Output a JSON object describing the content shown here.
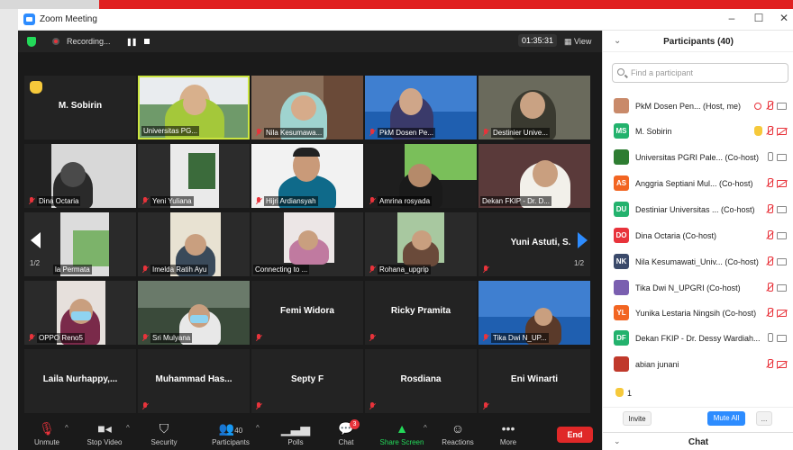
{
  "window": {
    "title": "Zoom Meeting",
    "controls": [
      "–",
      "☐",
      "✕"
    ]
  },
  "topbar": {
    "recording_label": "Recording...",
    "timer": "01:35:31",
    "view_label": "View"
  },
  "tiles": [
    {
      "name": "M. Sobirin",
      "label": "",
      "hand": true
    },
    {
      "name": "",
      "label": "Universitas PG...",
      "selected": true
    },
    {
      "name": "",
      "label": "Nila Kesumawa..."
    },
    {
      "name": "",
      "label": "PkM Dosen Pe..."
    },
    {
      "name": "",
      "label": "Destinier Unive..."
    },
    {
      "name": "",
      "label": "Dina Octaria"
    },
    {
      "name": "",
      "label": "Yeni Yuliana"
    },
    {
      "name": "",
      "label": "Hijri Ardiansyah"
    },
    {
      "name": "",
      "label": "Amrina rosyada"
    },
    {
      "name": "",
      "label": "Dekan FKIP - Dr. D..."
    },
    {
      "name": "",
      "label": "la Permata"
    },
    {
      "name": "",
      "label": "Imelda Ratih Ayu"
    },
    {
      "name": "",
      "label": "Connecting to ..."
    },
    {
      "name": "",
      "label": "Rohana_upgrip"
    },
    {
      "name": "Yuni Astuti, S.",
      "label": ""
    },
    {
      "name": "",
      "label": "OPPO Reno5"
    },
    {
      "name": "",
      "label": "Sri Mulyana"
    },
    {
      "name": "Femi Widora",
      "label": ""
    },
    {
      "name": "Ricky Pramita",
      "label": ""
    },
    {
      "name": "",
      "label": "Tika Dwi N_UP..."
    },
    {
      "name": "Laila Nurhappy,...",
      "label": ""
    },
    {
      "name": "Muhammad Has...",
      "label": ""
    },
    {
      "name": "Septy F",
      "label": ""
    },
    {
      "name": "Rosdiana",
      "label": ""
    },
    {
      "name": "Eni Winarti",
      "label": ""
    }
  ],
  "pager": {
    "left": "1/2",
    "right": "1/2"
  },
  "toolbar": {
    "unmute": "Unmute",
    "stop_video": "Stop Video",
    "security": "Security",
    "participants": "Participants",
    "participants_count": "40",
    "polls": "Polls",
    "chat": "Chat",
    "chat_badge": "3",
    "share_screen": "Share Screen",
    "reactions": "Reactions",
    "more": "More",
    "end": "End"
  },
  "panel": {
    "title": "Participants (40)",
    "search_placeholder": "Find a participant",
    "participants": [
      {
        "name": "PkM Dosen Pen...  (Host, me)",
        "initials": "",
        "color": "#c98a6a"
      },
      {
        "name": "M. Sobirin",
        "initials": "MS",
        "color": "#23b26d"
      },
      {
        "name": "Universitas PGRI Pale... (Co-host)",
        "initials": "",
        "color": "#2e7d32"
      },
      {
        "name": "Anggria Septiani Mul... (Co-host)",
        "initials": "AS",
        "color": "#f26522"
      },
      {
        "name": "Destiniar Universitas ... (Co-host)",
        "initials": "DU",
        "color": "#23b26d"
      },
      {
        "name": "Dina Octaria (Co-host)",
        "initials": "DO",
        "color": "#e8333b"
      },
      {
        "name": "Nila Kesumawati_Univ... (Co-host)",
        "initials": "NK",
        "color": "#3b4a6b"
      },
      {
        "name": "Tika Dwi N_UPGRI (Co-host)",
        "initials": "",
        "color": "#7a5fb0"
      },
      {
        "name": "Yunika Lestaria Ningsih (Co-host)",
        "initials": "YL",
        "color": "#f26522"
      },
      {
        "name": "Dekan FKIP - Dr. Dessy Wardiah...",
        "initials": "DF",
        "color": "#23b26d"
      },
      {
        "name": "abian junani",
        "initials": "",
        "color": "#c0392b"
      }
    ],
    "hand_count": "1",
    "invite": "Invite",
    "mute_all": "Mute All",
    "more": "...",
    "chat": "Chat"
  },
  "colors": {
    "accent": "#2d8cff",
    "mute_red": "#e8333b",
    "share_green": "#23d959",
    "end_red": "#e02828"
  }
}
